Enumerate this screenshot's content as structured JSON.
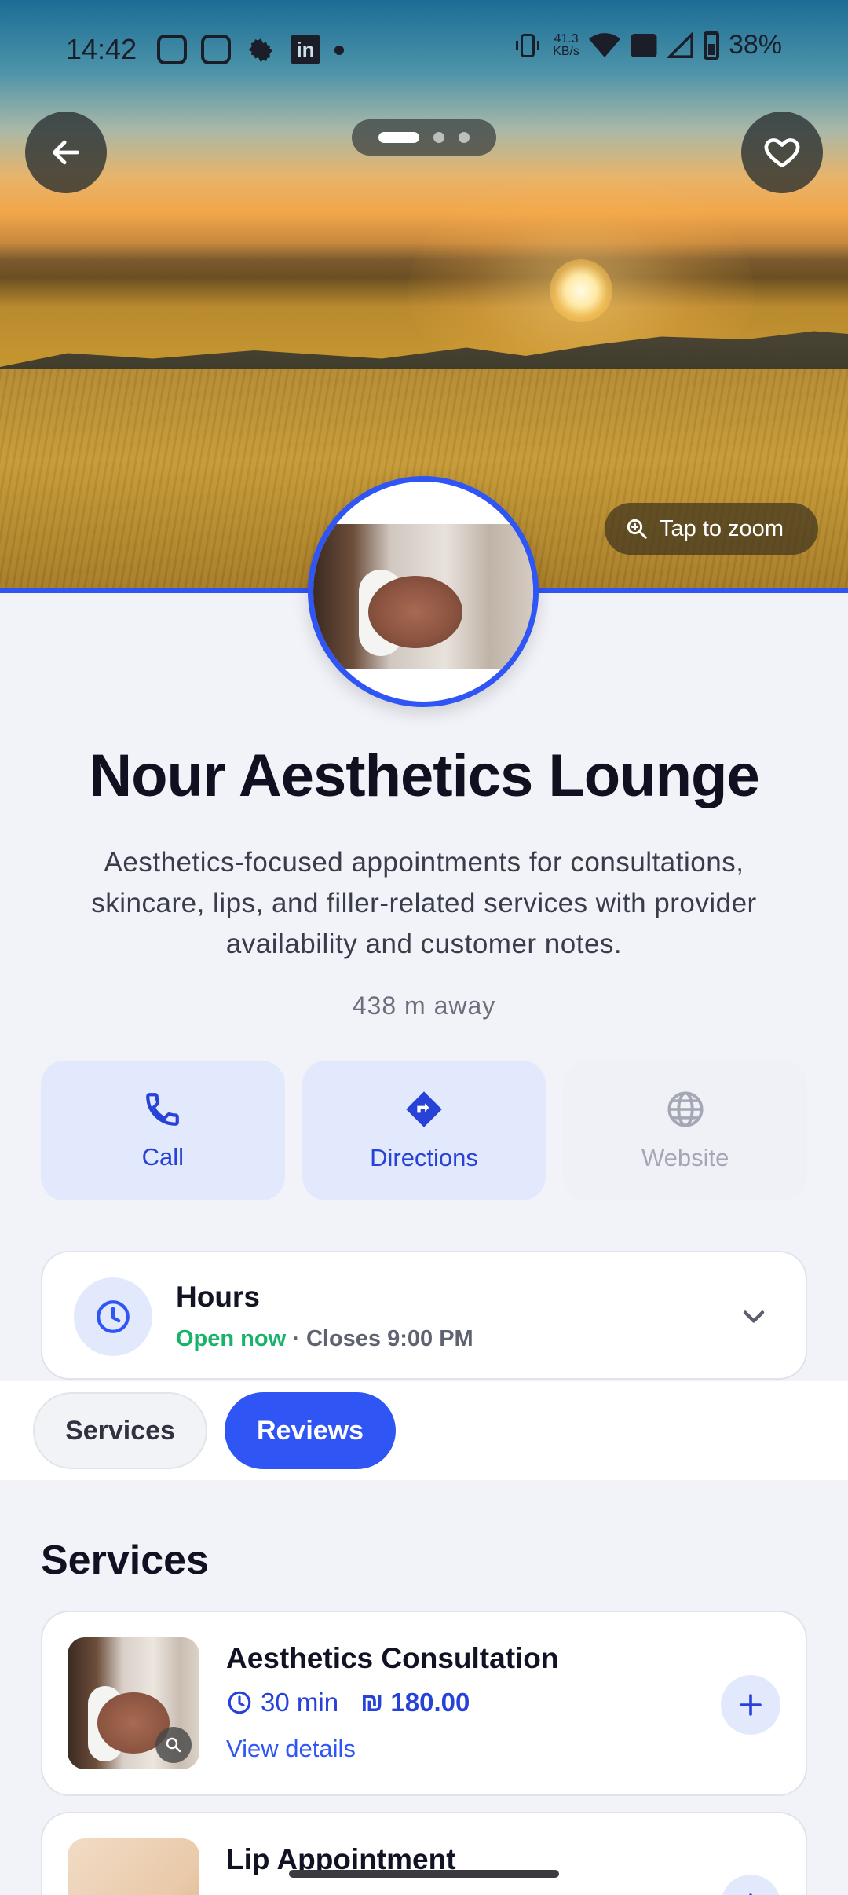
{
  "status_bar": {
    "time": "14:42",
    "net_speed_value": "41.3",
    "net_speed_unit": "KB/s",
    "battery": "38%",
    "notification_icons": [
      "camera-app-icon",
      "instagram-icon",
      "settings-gear-icon",
      "linkedin-icon"
    ]
  },
  "hero": {
    "zoom_hint": "Tap to zoom",
    "pager_count": 3,
    "pager_active": 0
  },
  "business": {
    "name": "Nour Aesthetics Lounge",
    "description": "Aesthetics-focused appointments for consultations, skincare, lips, and filler-related services with provider availability and customer notes.",
    "distance": "438 m away"
  },
  "actions": {
    "call": "Call",
    "directions": "Directions",
    "website": "Website"
  },
  "hours": {
    "title": "Hours",
    "status": "Open now",
    "closes": " · Closes 9:00 PM"
  },
  "tabs": {
    "services": "Services",
    "reviews": "Reviews",
    "active": "Reviews"
  },
  "services_section": {
    "title": "Services",
    "items": [
      {
        "name": "Aesthetics Consultation",
        "duration": "30 min",
        "currency": "₪",
        "price": "180.00",
        "link": "View details"
      },
      {
        "name": "Lip Appointment"
      }
    ]
  },
  "colors": {
    "accent": "#2f55f5",
    "accent_soft": "#e3e9fd",
    "open_green": "#19b26b"
  }
}
